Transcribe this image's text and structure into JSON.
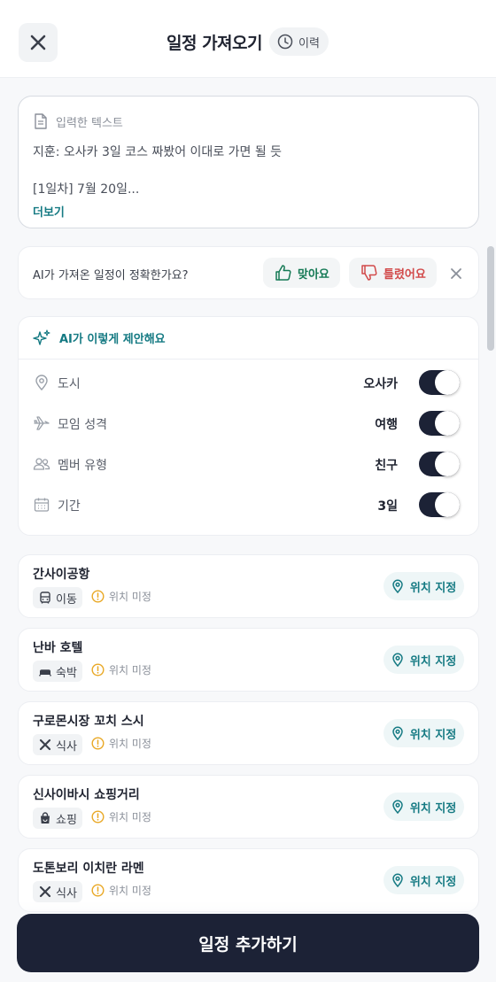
{
  "header": {
    "close_icon": "close-icon",
    "title": "일정 가져오기",
    "history_label": "이력",
    "history_icon": "clock-icon"
  },
  "input_card": {
    "heading": "입력한 텍스트",
    "heading_icon": "document-icon",
    "line1": "지훈: 오사카 3일 코스 짜봤어 이대로 가면 될 듯",
    "line2": "[1일차] 7월 20일...",
    "more_label": "더보기"
  },
  "feedback": {
    "question": "AI가 가져온 일정이 정확한가요?",
    "yes_label": "맞아요",
    "no_label": "틀렸어요"
  },
  "suggestion": {
    "title": "AI가 이렇게 제안해요",
    "rows": [
      {
        "icon": "pin-icon",
        "label": "도시",
        "value": "오사카",
        "enabled": true
      },
      {
        "icon": "plane-icon",
        "label": "모임 성격",
        "value": "여행",
        "enabled": true
      },
      {
        "icon": "people-icon",
        "label": "멤버 유형",
        "value": "친구",
        "enabled": true
      },
      {
        "icon": "calendar-icon",
        "label": "기간",
        "value": "3일",
        "enabled": true
      }
    ]
  },
  "places": [
    {
      "name": "간사이공항",
      "category": "이동",
      "category_icon": "bus-icon",
      "status": "위치 미정",
      "action": "위치 지정"
    },
    {
      "name": "난바 호텔",
      "category": "숙박",
      "category_icon": "bed-icon",
      "status": "위치 미정",
      "action": "위치 지정"
    },
    {
      "name": "구로몬시장 꼬치 스시",
      "category": "식사",
      "category_icon": "utensils-icon",
      "status": "위치 미정",
      "action": "위치 지정"
    },
    {
      "name": "신사이바시 쇼핑거리",
      "category": "쇼핑",
      "category_icon": "shopping-bag-icon",
      "status": "위치 미정",
      "action": "위치 지정"
    },
    {
      "name": "도톤보리 이치란 라멘",
      "category": "식사",
      "category_icon": "utensils-icon",
      "status": "위치 미정",
      "action": "위치 지정"
    }
  ],
  "cta_label": "일정 추가하기",
  "colors": {
    "primary_dark": "#1c2236",
    "accent_teal": "#157a83",
    "positive": "#157a55",
    "negative": "#d24a4a",
    "warning": "#e9a825"
  }
}
